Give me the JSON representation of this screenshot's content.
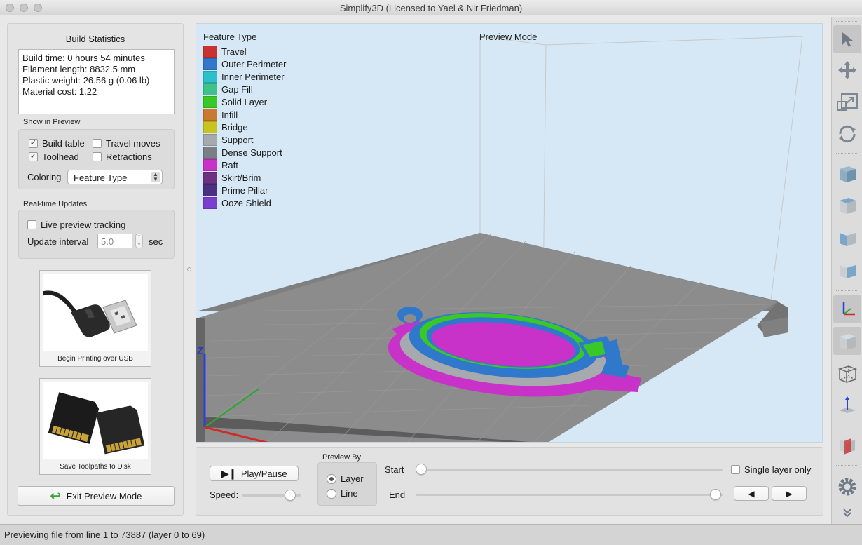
{
  "window": {
    "title": "Simplify3D (Licensed to Yael & Nir Friedman)"
  },
  "left_panel": {
    "build_stats_title": "Build Statistics",
    "stats": {
      "line1": "Build time: 0 hours 54 minutes",
      "line2": "Filament length: 8832.5 mm",
      "line3": "Plastic weight: 26.56 g (0.06 lb)",
      "line4": "Material cost: 1.22"
    },
    "show_in_preview": {
      "label": "Show in Preview",
      "build_table": {
        "label": "Build table",
        "checked": true
      },
      "travel_moves": {
        "label": "Travel moves",
        "checked": false
      },
      "toolhead": {
        "label": "Toolhead",
        "checked": true
      },
      "retractions": {
        "label": "Retractions",
        "checked": false
      },
      "coloring_label": "Coloring",
      "coloring_value": "Feature Type"
    },
    "realtime": {
      "label": "Real-time Updates",
      "live_tracking": {
        "label": "Live preview tracking",
        "checked": false
      },
      "interval_label": "Update interval",
      "interval_value": "5.0",
      "interval_unit": "sec"
    },
    "usb_button_caption": "Begin Printing over USB",
    "disk_button_caption": "Save Toolpaths to Disk",
    "exit_label": "Exit Preview Mode"
  },
  "viewport": {
    "legend_title": "Feature Type",
    "mode_title": "Preview Mode",
    "legend": [
      {
        "label": "Travel",
        "color": "#c83232"
      },
      {
        "label": "Outer Perimeter",
        "color": "#2f78cc"
      },
      {
        "label": "Inner Perimeter",
        "color": "#2cc0cc"
      },
      {
        "label": "Gap Fill",
        "color": "#3fc28a"
      },
      {
        "label": "Solid Layer",
        "color": "#3ac828"
      },
      {
        "label": "Infill",
        "color": "#c87a30"
      },
      {
        "label": "Bridge",
        "color": "#c8c31e"
      },
      {
        "label": "Support",
        "color": "#a6a9ad"
      },
      {
        "label": "Dense Support",
        "color": "#7b7e84"
      },
      {
        "label": "Raft",
        "color": "#c832c8"
      },
      {
        "label": "Skirt/Brim",
        "color": "#6e3080"
      },
      {
        "label": "Prime Pillar",
        "color": "#4b2f80"
      },
      {
        "label": "Ooze Shield",
        "color": "#7a3fd0"
      }
    ],
    "axis_label": "Z"
  },
  "controls": {
    "play_label": "Play/Pause",
    "speed_label": "Speed:",
    "speed_level": 0.9,
    "preview_by_label": "Preview By",
    "layer_label": "Layer",
    "line_label": "Line",
    "layer_selected": true,
    "start_label": "Start",
    "end_label": "End",
    "start_level": 0.0,
    "end_level": 1.0,
    "single_layer_label": "Single layer only",
    "single_layer_checked": false
  },
  "toolbar": [
    "select-arrow-icon",
    "move-icon",
    "scale-icon",
    "rotate-icon",
    "default-view-icon",
    "top-view-icon",
    "front-view-icon",
    "side-view-icon",
    "axes-icon",
    "solid-cube-icon",
    "wireframe-cube-icon",
    "build-plate-icon",
    "cross-section-icon",
    "gear-icon",
    "expand-chevron-icon"
  ],
  "status": {
    "text": "Previewing file from line 1 to 73887 (layer 0 to 69)"
  }
}
